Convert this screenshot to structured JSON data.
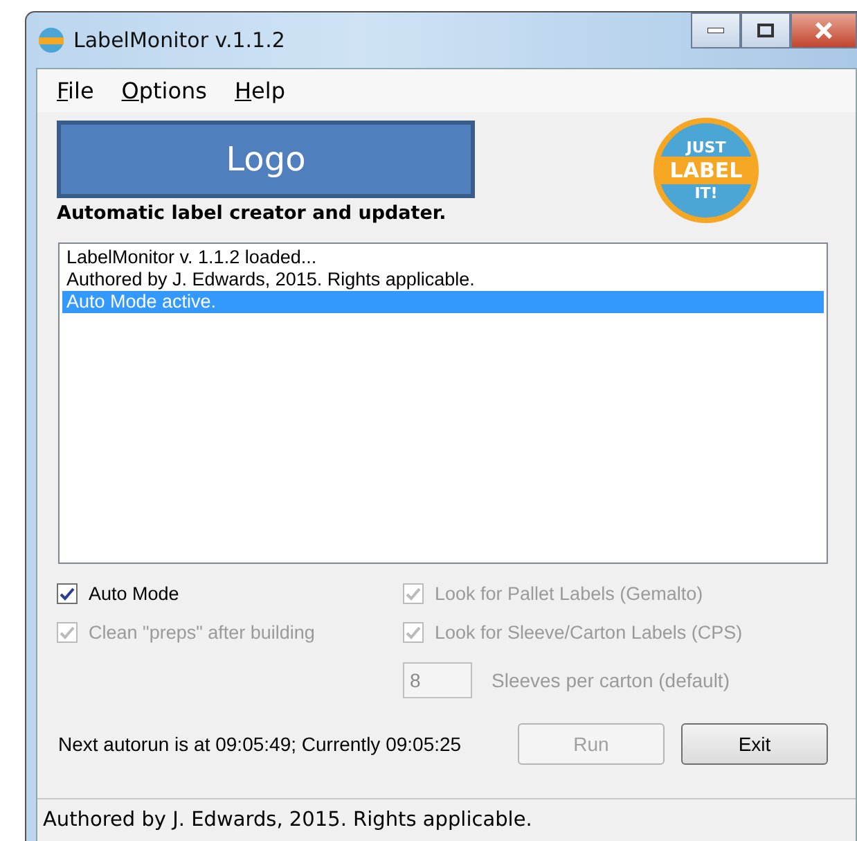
{
  "window": {
    "title": "LabelMonitor v.1.1.2"
  },
  "menu": [
    "File",
    "Options",
    "Help"
  ],
  "logo": {
    "text": "Logo"
  },
  "badge": {
    "lines": [
      "JUST",
      "LABEL",
      "IT!"
    ]
  },
  "tagline": "Automatic label creator and updater.",
  "log": [
    {
      "text": "LabelMonitor v. 1.1.2 loaded...",
      "selected": false
    },
    {
      "text": "Authored by J. Edwards, 2015. Rights applicable.",
      "selected": false
    },
    {
      "text": "Auto Mode active.",
      "selected": true
    }
  ],
  "options": [
    {
      "label": "Auto Mode",
      "checked": true,
      "disabled": false
    },
    {
      "label": "Look for Pallet Labels (Gemalto)",
      "checked": true,
      "disabled": true
    },
    {
      "label": "Clean \"preps\" after building",
      "checked": true,
      "disabled": true
    },
    {
      "label": "Look for Sleeve/Carton Labels (CPS)",
      "checked": true,
      "disabled": true
    }
  ],
  "sleeves": {
    "value": "8",
    "label": "Sleeves per carton (default)",
    "disabled": true
  },
  "schedule": "Next autorun is at 09:05:49; Currently 09:05:25",
  "buttons": [
    {
      "label": "Run",
      "disabled": true
    },
    {
      "label": "Exit",
      "disabled": false
    }
  ],
  "status_bar": "Authored by J. Edwards, 2015. Rights applicable."
}
